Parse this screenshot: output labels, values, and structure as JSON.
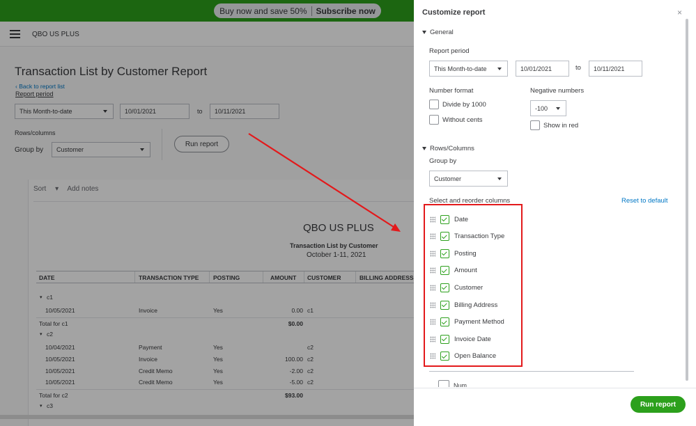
{
  "promo": {
    "text": "Buy now and save 50%",
    "cta": "Subscribe now"
  },
  "app": {
    "company": "QBO US PLUS"
  },
  "report": {
    "title": "Transaction List by Customer Report",
    "back_link": "Back to report list",
    "period_label": "Report period",
    "period_value": "This Month-to-date",
    "from": "10/01/2021",
    "to_label": "to",
    "to": "10/11/2021",
    "rows_columns_label": "Rows/columns",
    "group_by_label": "Group by",
    "group_by_value": "Customer",
    "run_button": "Run report",
    "sort": "Sort",
    "add_notes": "Add notes",
    "company_name": "QBO US PLUS",
    "report_name": "Transaction List by Customer",
    "date_range": "October 1-11, 2021",
    "columns": [
      "DATE",
      "TRANSACTION TYPE",
      "POSTING",
      "AMOUNT",
      "CUSTOMER",
      "BILLING ADDRESS"
    ],
    "rows": [
      {
        "kind": "group",
        "label": "c1"
      },
      {
        "kind": "data",
        "date": "10/05/2021",
        "type": "Invoice",
        "posting": "Yes",
        "amount": "0.00",
        "customer": "c1"
      },
      {
        "kind": "total",
        "label": "Total for c1",
        "amount": "$0.00"
      },
      {
        "kind": "group",
        "label": "c2"
      },
      {
        "kind": "data",
        "date": "10/04/2021",
        "type": "Payment",
        "posting": "Yes",
        "amount": "",
        "customer": "c2"
      },
      {
        "kind": "data",
        "date": "10/05/2021",
        "type": "Invoice",
        "posting": "Yes",
        "amount": "100.00",
        "customer": "c2"
      },
      {
        "kind": "data",
        "date": "10/05/2021",
        "type": "Credit Memo",
        "posting": "Yes",
        "amount": "-2.00",
        "customer": "c2"
      },
      {
        "kind": "data",
        "date": "10/05/2021",
        "type": "Credit Memo",
        "posting": "Yes",
        "amount": "-5.00",
        "customer": "c2"
      },
      {
        "kind": "total",
        "label": "Total for c2",
        "amount": "$93.00"
      },
      {
        "kind": "group",
        "label": "c3"
      }
    ]
  },
  "panel": {
    "title": "Customize report",
    "close": "×",
    "general_label": "General",
    "report_period_label": "Report period",
    "period_value": "This Month-to-date",
    "from": "10/01/2021",
    "to_label": "to",
    "to": "10/11/2021",
    "number_format_label": "Number format",
    "divide_by_1000": "Divide by 1000",
    "without_cents": "Without cents",
    "negative_numbers_label": "Negative numbers",
    "negative_value": "-100",
    "show_in_red": "Show in red",
    "rows_columns_label": "Rows/Columns",
    "group_by_label": "Group by",
    "group_by_value": "Customer",
    "select_columns_label": "Select and reorder columns",
    "reset_link": "Reset to default",
    "columns": [
      "Date",
      "Transaction Type",
      "Posting",
      "Amount",
      "Customer",
      "Billing Address",
      "Payment Method",
      "Invoice Date",
      "Open Balance"
    ],
    "partial_item": "Num",
    "run_button": "Run report"
  },
  "colors": {
    "brand_green": "#2ca01c",
    "link_blue": "#0077c5",
    "highlight_red": "#e3191b"
  }
}
